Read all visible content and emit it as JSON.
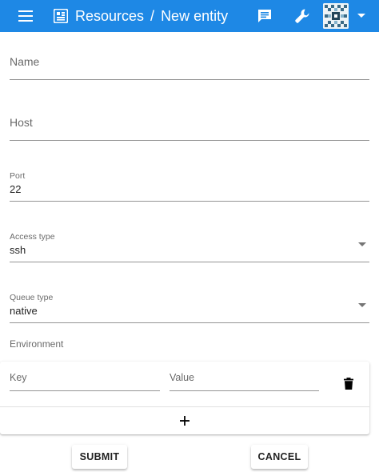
{
  "header": {
    "title_root": "Resources",
    "separator": "/",
    "title_page": "New entity",
    "icons": [
      "menu-icon",
      "resources-icon",
      "chat-icon",
      "wrench-icon",
      "avatar",
      "chevron-down-icon"
    ],
    "bar_color": "#1e88e5"
  },
  "form": {
    "name": {
      "label": "Name",
      "value": ""
    },
    "host": {
      "label": "Host",
      "value": ""
    },
    "port": {
      "label": "Port",
      "value": "22"
    },
    "access_type": {
      "label": "Access type",
      "value": "ssh"
    },
    "queue_type": {
      "label": "Queue type",
      "value": "native"
    },
    "environment": {
      "title": "Environment",
      "key_placeholder": "Key",
      "value_placeholder": "Value",
      "add_symbol": "+"
    }
  },
  "actions": {
    "submit_label": "SUBMIT",
    "cancel_label": "CANCEL"
  }
}
